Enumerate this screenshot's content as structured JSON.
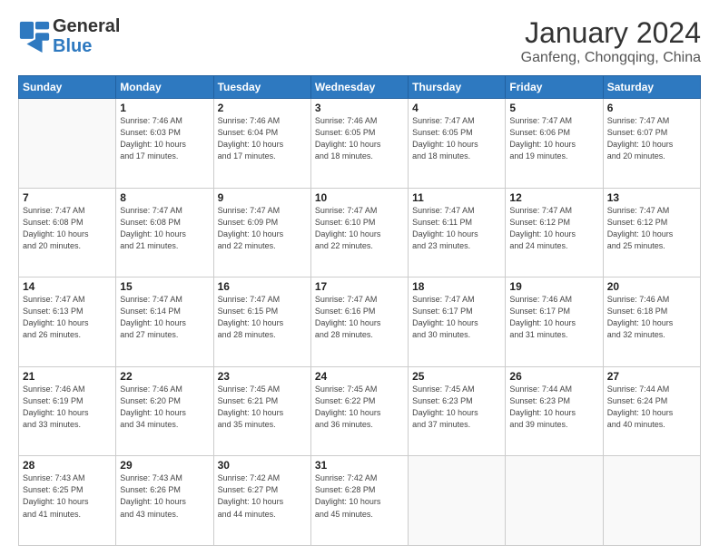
{
  "header": {
    "logo_general": "General",
    "logo_blue": "Blue",
    "month_title": "January 2024",
    "location": "Ganfeng, Chongqing, China"
  },
  "calendar": {
    "days_of_week": [
      "Sunday",
      "Monday",
      "Tuesday",
      "Wednesday",
      "Thursday",
      "Friday",
      "Saturday"
    ],
    "weeks": [
      [
        {
          "day": "",
          "info": ""
        },
        {
          "day": "1",
          "info": "Sunrise: 7:46 AM\nSunset: 6:03 PM\nDaylight: 10 hours\nand 17 minutes."
        },
        {
          "day": "2",
          "info": "Sunrise: 7:46 AM\nSunset: 6:04 PM\nDaylight: 10 hours\nand 17 minutes."
        },
        {
          "day": "3",
          "info": "Sunrise: 7:46 AM\nSunset: 6:05 PM\nDaylight: 10 hours\nand 18 minutes."
        },
        {
          "day": "4",
          "info": "Sunrise: 7:47 AM\nSunset: 6:05 PM\nDaylight: 10 hours\nand 18 minutes."
        },
        {
          "day": "5",
          "info": "Sunrise: 7:47 AM\nSunset: 6:06 PM\nDaylight: 10 hours\nand 19 minutes."
        },
        {
          "day": "6",
          "info": "Sunrise: 7:47 AM\nSunset: 6:07 PM\nDaylight: 10 hours\nand 20 minutes."
        }
      ],
      [
        {
          "day": "7",
          "info": "Sunrise: 7:47 AM\nSunset: 6:08 PM\nDaylight: 10 hours\nand 20 minutes."
        },
        {
          "day": "8",
          "info": "Sunrise: 7:47 AM\nSunset: 6:08 PM\nDaylight: 10 hours\nand 21 minutes."
        },
        {
          "day": "9",
          "info": "Sunrise: 7:47 AM\nSunset: 6:09 PM\nDaylight: 10 hours\nand 22 minutes."
        },
        {
          "day": "10",
          "info": "Sunrise: 7:47 AM\nSunset: 6:10 PM\nDaylight: 10 hours\nand 22 minutes."
        },
        {
          "day": "11",
          "info": "Sunrise: 7:47 AM\nSunset: 6:11 PM\nDaylight: 10 hours\nand 23 minutes."
        },
        {
          "day": "12",
          "info": "Sunrise: 7:47 AM\nSunset: 6:12 PM\nDaylight: 10 hours\nand 24 minutes."
        },
        {
          "day": "13",
          "info": "Sunrise: 7:47 AM\nSunset: 6:12 PM\nDaylight: 10 hours\nand 25 minutes."
        }
      ],
      [
        {
          "day": "14",
          "info": "Sunrise: 7:47 AM\nSunset: 6:13 PM\nDaylight: 10 hours\nand 26 minutes."
        },
        {
          "day": "15",
          "info": "Sunrise: 7:47 AM\nSunset: 6:14 PM\nDaylight: 10 hours\nand 27 minutes."
        },
        {
          "day": "16",
          "info": "Sunrise: 7:47 AM\nSunset: 6:15 PM\nDaylight: 10 hours\nand 28 minutes."
        },
        {
          "day": "17",
          "info": "Sunrise: 7:47 AM\nSunset: 6:16 PM\nDaylight: 10 hours\nand 28 minutes."
        },
        {
          "day": "18",
          "info": "Sunrise: 7:47 AM\nSunset: 6:17 PM\nDaylight: 10 hours\nand 30 minutes."
        },
        {
          "day": "19",
          "info": "Sunrise: 7:46 AM\nSunset: 6:17 PM\nDaylight: 10 hours\nand 31 minutes."
        },
        {
          "day": "20",
          "info": "Sunrise: 7:46 AM\nSunset: 6:18 PM\nDaylight: 10 hours\nand 32 minutes."
        }
      ],
      [
        {
          "day": "21",
          "info": "Sunrise: 7:46 AM\nSunset: 6:19 PM\nDaylight: 10 hours\nand 33 minutes."
        },
        {
          "day": "22",
          "info": "Sunrise: 7:46 AM\nSunset: 6:20 PM\nDaylight: 10 hours\nand 34 minutes."
        },
        {
          "day": "23",
          "info": "Sunrise: 7:45 AM\nSunset: 6:21 PM\nDaylight: 10 hours\nand 35 minutes."
        },
        {
          "day": "24",
          "info": "Sunrise: 7:45 AM\nSunset: 6:22 PM\nDaylight: 10 hours\nand 36 minutes."
        },
        {
          "day": "25",
          "info": "Sunrise: 7:45 AM\nSunset: 6:23 PM\nDaylight: 10 hours\nand 37 minutes."
        },
        {
          "day": "26",
          "info": "Sunrise: 7:44 AM\nSunset: 6:23 PM\nDaylight: 10 hours\nand 39 minutes."
        },
        {
          "day": "27",
          "info": "Sunrise: 7:44 AM\nSunset: 6:24 PM\nDaylight: 10 hours\nand 40 minutes."
        }
      ],
      [
        {
          "day": "28",
          "info": "Sunrise: 7:43 AM\nSunset: 6:25 PM\nDaylight: 10 hours\nand 41 minutes."
        },
        {
          "day": "29",
          "info": "Sunrise: 7:43 AM\nSunset: 6:26 PM\nDaylight: 10 hours\nand 43 minutes."
        },
        {
          "day": "30",
          "info": "Sunrise: 7:42 AM\nSunset: 6:27 PM\nDaylight: 10 hours\nand 44 minutes."
        },
        {
          "day": "31",
          "info": "Sunrise: 7:42 AM\nSunset: 6:28 PM\nDaylight: 10 hours\nand 45 minutes."
        },
        {
          "day": "",
          "info": ""
        },
        {
          "day": "",
          "info": ""
        },
        {
          "day": "",
          "info": ""
        }
      ]
    ]
  }
}
